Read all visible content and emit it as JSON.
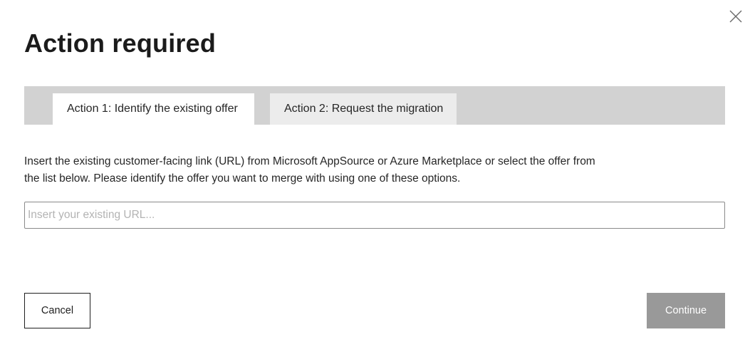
{
  "dialog": {
    "title": "Action required",
    "close_icon": "close-icon"
  },
  "tabs": [
    {
      "label": "Action 1: Identify the existing offer",
      "active": true
    },
    {
      "label": "Action 2: Request the migration",
      "active": false
    }
  ],
  "content": {
    "description": "Insert the existing customer-facing link (URL) from Microsoft AppSource or Azure Marketplace or select the offer from the list below. Please identify the offer you want to merge with using one of these options.",
    "url_input": {
      "value": "",
      "placeholder": "Insert your existing URL..."
    }
  },
  "footer": {
    "cancel_label": "Cancel",
    "continue_label": "Continue"
  },
  "colors": {
    "tab_strip_bg": "#d2d2d2",
    "active_tab_bg": "#ffffff",
    "inactive_tab_bg": "#ececec",
    "continue_disabled_bg": "#999999"
  }
}
